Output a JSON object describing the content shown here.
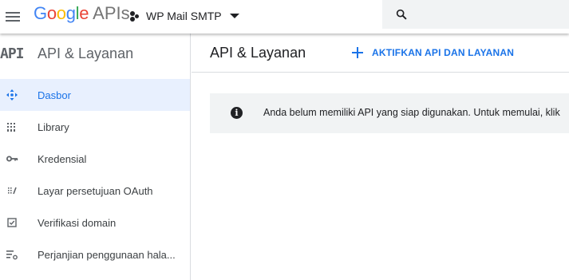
{
  "header": {
    "logo": {
      "google_letters": [
        {
          "char": "G",
          "color": "#4285F4"
        },
        {
          "char": "o",
          "color": "#EA4335"
        },
        {
          "char": "o",
          "color": "#FBBC05"
        },
        {
          "char": "g",
          "color": "#4285F4"
        },
        {
          "char": "l",
          "color": "#34A853"
        },
        {
          "char": "e",
          "color": "#EA4335"
        }
      ],
      "suffix": "APIs"
    },
    "project_name": "WP Mail SMTP",
    "search_placeholder": ""
  },
  "sidebar": {
    "api_mark": "API",
    "title": "API & Layanan",
    "items": [
      {
        "label": "Dasbor",
        "icon": "dashboard-icon",
        "active": true
      },
      {
        "label": "Library",
        "icon": "library-icon",
        "active": false
      },
      {
        "label": "Kredensial",
        "icon": "key-icon",
        "active": false
      },
      {
        "label": "Layar persetujuan OAuth",
        "icon": "consent-screen-icon",
        "active": false
      },
      {
        "label": "Verifikasi domain",
        "icon": "checkbox-icon",
        "active": false
      },
      {
        "label": "Perjanjian penggunaan hala...",
        "icon": "settings-list-icon",
        "active": false
      }
    ]
  },
  "main": {
    "title": "API & Layanan",
    "enable_button": "AKTIFKAN API DAN LAYANAN",
    "notice": "Anda belum memiliki API yang siap digunakan. Untuk memulai, klik"
  },
  "colors": {
    "accent": "#1a73e8",
    "active_bg": "#e8f0fe",
    "notice_bg": "#f1f3f4",
    "search_bg": "#f1f3f4"
  }
}
